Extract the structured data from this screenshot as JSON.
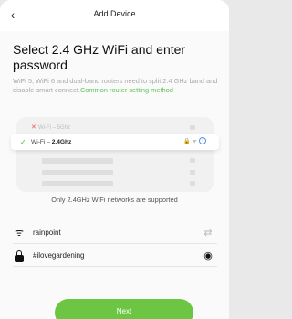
{
  "header": {
    "back_icon": "chevron-left-icon",
    "back_glyph": "‹",
    "title": "Add Device"
  },
  "main": {
    "heading": "Select 2.4 GHz WiFi and enter password",
    "description": "WiFi 5, WiFi 6 and dual-band routers need to split 2.4 GHz band and disable smart connect.",
    "description_link": "Common router setting method"
  },
  "illustration": {
    "bad_mark": "✕",
    "bad_label": "Wi-Fi – 5Ghz",
    "good_mark": "✓",
    "good_label_prefix": "Wi-Fi – ",
    "good_label_band": "2.4Ghz",
    "good_icons": "🔒 ᯤ",
    "info_glyph": "i"
  },
  "support_note": "Only 2.4GHz WiFi networks are supported",
  "form": {
    "ssid_value": "rainpoint",
    "ssid_icon": "wifi-icon",
    "ssid_glyph": "ᯤ",
    "switch_icon": "switch-arrows-icon",
    "switch_glyph": "⇄",
    "password_value": "#ilovegardening",
    "password_icon": "lock-icon",
    "eye_icon": "eye-icon",
    "eye_glyph": "◉"
  },
  "next_button": {
    "label": "Next"
  },
  "colors": {
    "accent": "#6cc644",
    "link": "#5cc25a",
    "error": "#e55555"
  }
}
